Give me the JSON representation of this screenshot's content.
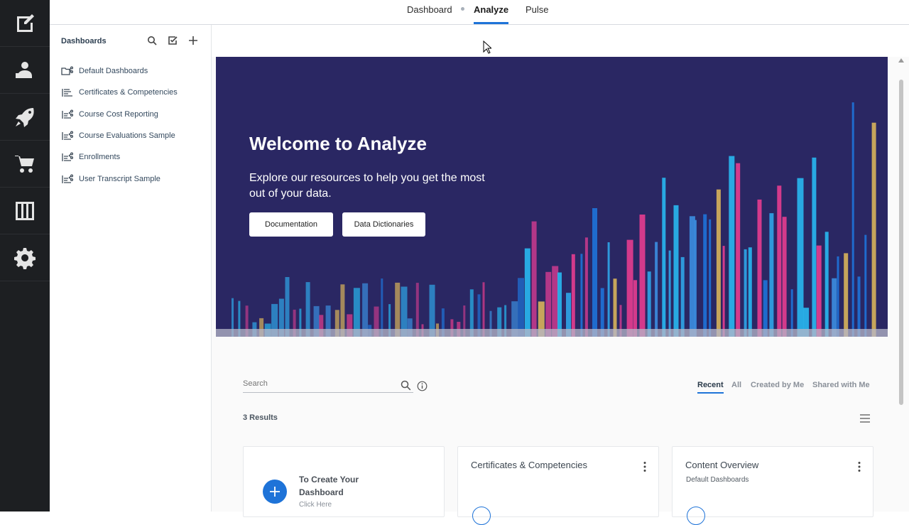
{
  "rail": {
    "items": [
      {
        "icon": "edit-note-icon"
      },
      {
        "icon": "people-icon"
      },
      {
        "icon": "rocket-icon"
      },
      {
        "icon": "cart-icon"
      },
      {
        "icon": "columns-icon"
      },
      {
        "icon": "gear-icon"
      }
    ]
  },
  "topnav": {
    "tabs": [
      {
        "label": "Dashboard",
        "active": false
      },
      {
        "label": "Analyze",
        "active": true
      },
      {
        "label": "Pulse",
        "active": false
      }
    ]
  },
  "sidebar": {
    "title": "Dashboards",
    "items": [
      {
        "label": "Default Dashboards",
        "icon": "folder-share-icon"
      },
      {
        "label": "Certificates & Competencies",
        "icon": "list-icon"
      },
      {
        "label": "Course Cost Reporting",
        "icon": "shared-list-icon"
      },
      {
        "label": "Course Evaluations Sample",
        "icon": "shared-list-icon"
      },
      {
        "label": "Enrollments",
        "icon": "shared-list-icon"
      },
      {
        "label": "User Transcript Sample",
        "icon": "shared-list-icon"
      }
    ]
  },
  "hero": {
    "title": "Welcome to Analyze",
    "subtitle": "Explore our resources to help you get the most out of your data.",
    "buttons": {
      "documentation": "Documentation",
      "dictionaries": "Data Dictionaries"
    },
    "colors": {
      "background": "#2a2763",
      "bars": [
        "#e53d8f",
        "#2fa6e8",
        "#1e73d8",
        "#d8b45a",
        "#3b8ee0",
        "#c23a8c",
        "#28b8f0"
      ]
    }
  },
  "search": {
    "placeholder": "Search"
  },
  "filters": [
    "Recent",
    "All",
    "Created by Me",
    "Shared with Me"
  ],
  "results_label": "3 Results",
  "cards": [
    {
      "title": "To Create Your Dashboard",
      "sub": "Click Here"
    },
    {
      "title": "Certificates & Competencies",
      "sub": ""
    },
    {
      "title": "Content Overview",
      "sub": "Default Dashboards"
    }
  ],
  "accent": "#1e73d8"
}
